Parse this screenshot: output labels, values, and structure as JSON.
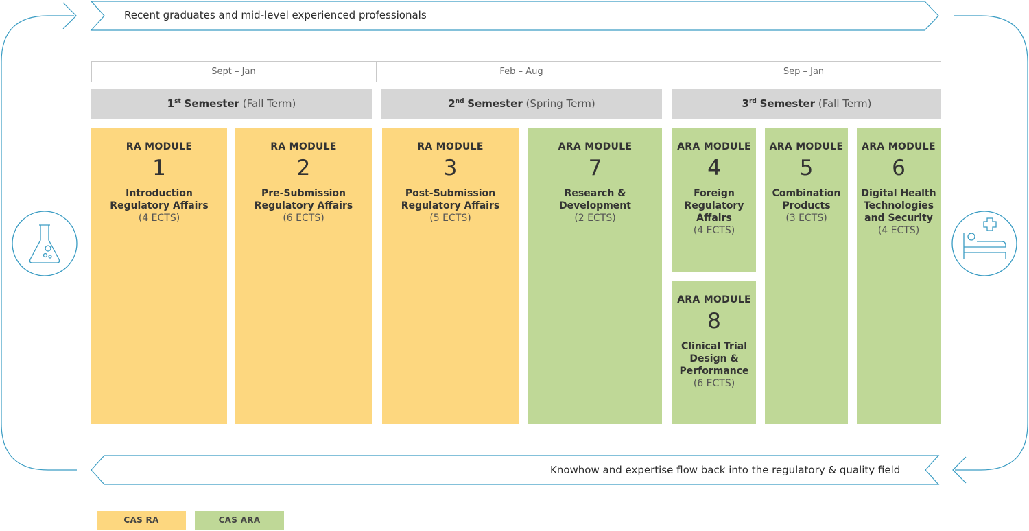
{
  "top_banner": "Recent graduates and mid-level experienced professionals",
  "bottom_banner": "Knowhow and expertise flow back into the regulatory & quality field",
  "periods": [
    "Sept – Jan",
    "Feb – Aug",
    "Sep – Jan"
  ],
  "semesters": [
    {
      "ordinal": "1",
      "suffix": "st",
      "name": "Semester",
      "term": "(Fall Term)"
    },
    {
      "ordinal": "2",
      "suffix": "nd",
      "name": "Semester",
      "term": "(Spring Term)"
    },
    {
      "ordinal": "3",
      "suffix": "rd",
      "name": "Semester",
      "term": "(Fall Term)"
    }
  ],
  "modules": {
    "m1": {
      "label": "RA MODULE",
      "number": "1",
      "title": "Introduction\nRegulatory Affairs",
      "ects": "(4 ECTS)"
    },
    "m2": {
      "label": "RA MODULE",
      "number": "2",
      "title": "Pre-Submission\nRegulatory Affairs",
      "ects": "(6 ECTS)"
    },
    "m3": {
      "label": "RA MODULE",
      "number": "3",
      "title": "Post-Submission\nRegulatory Affairs",
      "ects": "(5 ECTS)"
    },
    "m7": {
      "label": "ARA MODULE",
      "number": "7",
      "title": "Research &\nDevelopment",
      "ects": "(2 ECTS)"
    },
    "m4": {
      "label": "ARA MODULE",
      "number": "4",
      "title": "Foreign\nRegulatory\nAffairs",
      "ects": "(4 ECTS)"
    },
    "m5": {
      "label": "ARA MODULE",
      "number": "5",
      "title": "Combination\nProducts",
      "ects": "(3 ECTS)"
    },
    "m6": {
      "label": "ARA MODULE",
      "number": "6",
      "title": "Digital Health\nTechnologies\nand Security",
      "ects": "(4 ECTS)"
    },
    "m8": {
      "label": "ARA MODULE",
      "number": "8",
      "title": "Clinical Trial\nDesign &\nPerformance",
      "ects": "(6 ECTS)"
    }
  },
  "legend": {
    "ra": "CAS RA",
    "ara": "CAS ARA"
  },
  "colors": {
    "ra": "#fdd77f",
    "ara": "#bfd897",
    "semester": "#d6d6d6",
    "flow": "#3a9cc3"
  },
  "icons": {
    "left": "flask-icon",
    "right": "hospital-bed-icon"
  }
}
